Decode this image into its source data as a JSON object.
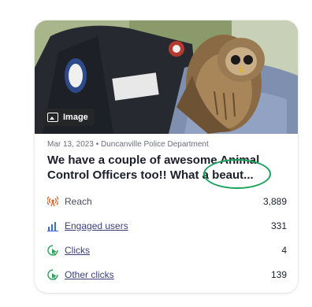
{
  "post": {
    "media_badge": "Image",
    "meta": "Mar 13, 2023 • Duncanville Police Department",
    "title": "We have a couple of awesome Animal Control Officers too!! What a beaut..."
  },
  "stats": [
    {
      "label": "Reach",
      "value": "3,889",
      "icon": "broadcast-icon",
      "link": false
    },
    {
      "label": "Engaged users",
      "value": "331",
      "icon": "bar-chart-icon",
      "link": true
    },
    {
      "label": "Clicks",
      "value": "4",
      "icon": "click-cursor-icon",
      "link": true
    },
    {
      "label": "Other clicks",
      "value": "139",
      "icon": "click-cursor-icon",
      "link": true
    }
  ],
  "colors": {
    "accent_green": "#1aa35a",
    "link": "#3b3f7c"
  }
}
